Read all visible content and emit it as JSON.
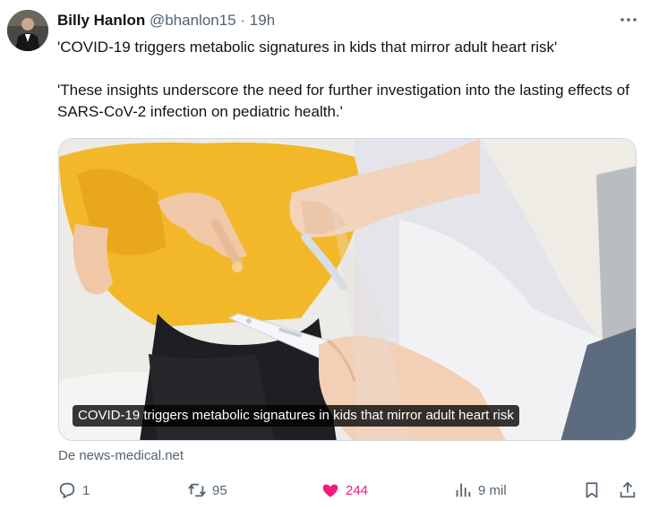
{
  "author": {
    "name": "Billy Hanlon",
    "handle": "@bhanlon15",
    "separator": "·",
    "time": "19h"
  },
  "tweet": {
    "line1": "'COVID-19 triggers metabolic signatures in kids that mirror adult heart risk'",
    "line2": "'These insights underscore the need for further investigation into the lasting effects of SARS-CoV-2 infection on pediatric health.'"
  },
  "media": {
    "caption": "COVID-19 triggers metabolic signatures in kids that mirror adult heart risk"
  },
  "card": {
    "source": "De news-medical.net"
  },
  "actions": {
    "replies": "1",
    "reposts": "95",
    "likes": "244",
    "views": "9 mil"
  },
  "colors": {
    "like_active": "#f91880",
    "secondary_text": "#536471",
    "primary_text": "#0f1419"
  },
  "icons": [
    "more-icon",
    "reply-icon",
    "repost-icon",
    "heart-icon",
    "views-icon",
    "bookmark-icon",
    "share-icon"
  ]
}
